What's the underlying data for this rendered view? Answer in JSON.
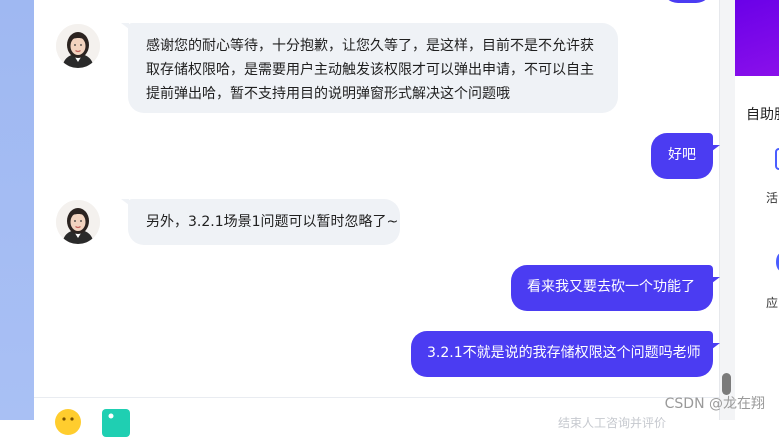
{
  "colors": {
    "outgoing_bubble": "#4b3cf2",
    "incoming_bubble": "#eff2f6",
    "side_banner": "#6a00e8",
    "accent": "#4a5dff"
  },
  "messages": [
    {
      "direction": "in",
      "avatar": "agent-avatar",
      "text": "感谢您的耐心等待，十分抱歉，让您久等了，是这样，目前不是不允许获取存储权限哈，是需要用户主动触发该权限才可以弹出申请，不可以自主提前弹出哈，暂不支持用目的说明弹窗形式解决这个问题哦"
    },
    {
      "direction": "out",
      "text": "好吧"
    },
    {
      "direction": "in",
      "avatar": "agent-avatar",
      "text": "另外，3.2.1场景1问题可以暂时忽略了~"
    },
    {
      "direction": "out",
      "text": "看来我又要去砍一个功能了"
    },
    {
      "direction": "out",
      "text": "3.2.1不就是说的我存储权限这个问题吗老师"
    }
  ],
  "side_panel": {
    "title": "自助服",
    "item_1_label": "活",
    "item_2_label": "应"
  },
  "footer": {
    "hint": "结束人工咨询并评价",
    "emoji_icon": "emoji-icon",
    "image_icon": "image-upload-icon"
  },
  "watermark": "CSDN @龙在翔"
}
